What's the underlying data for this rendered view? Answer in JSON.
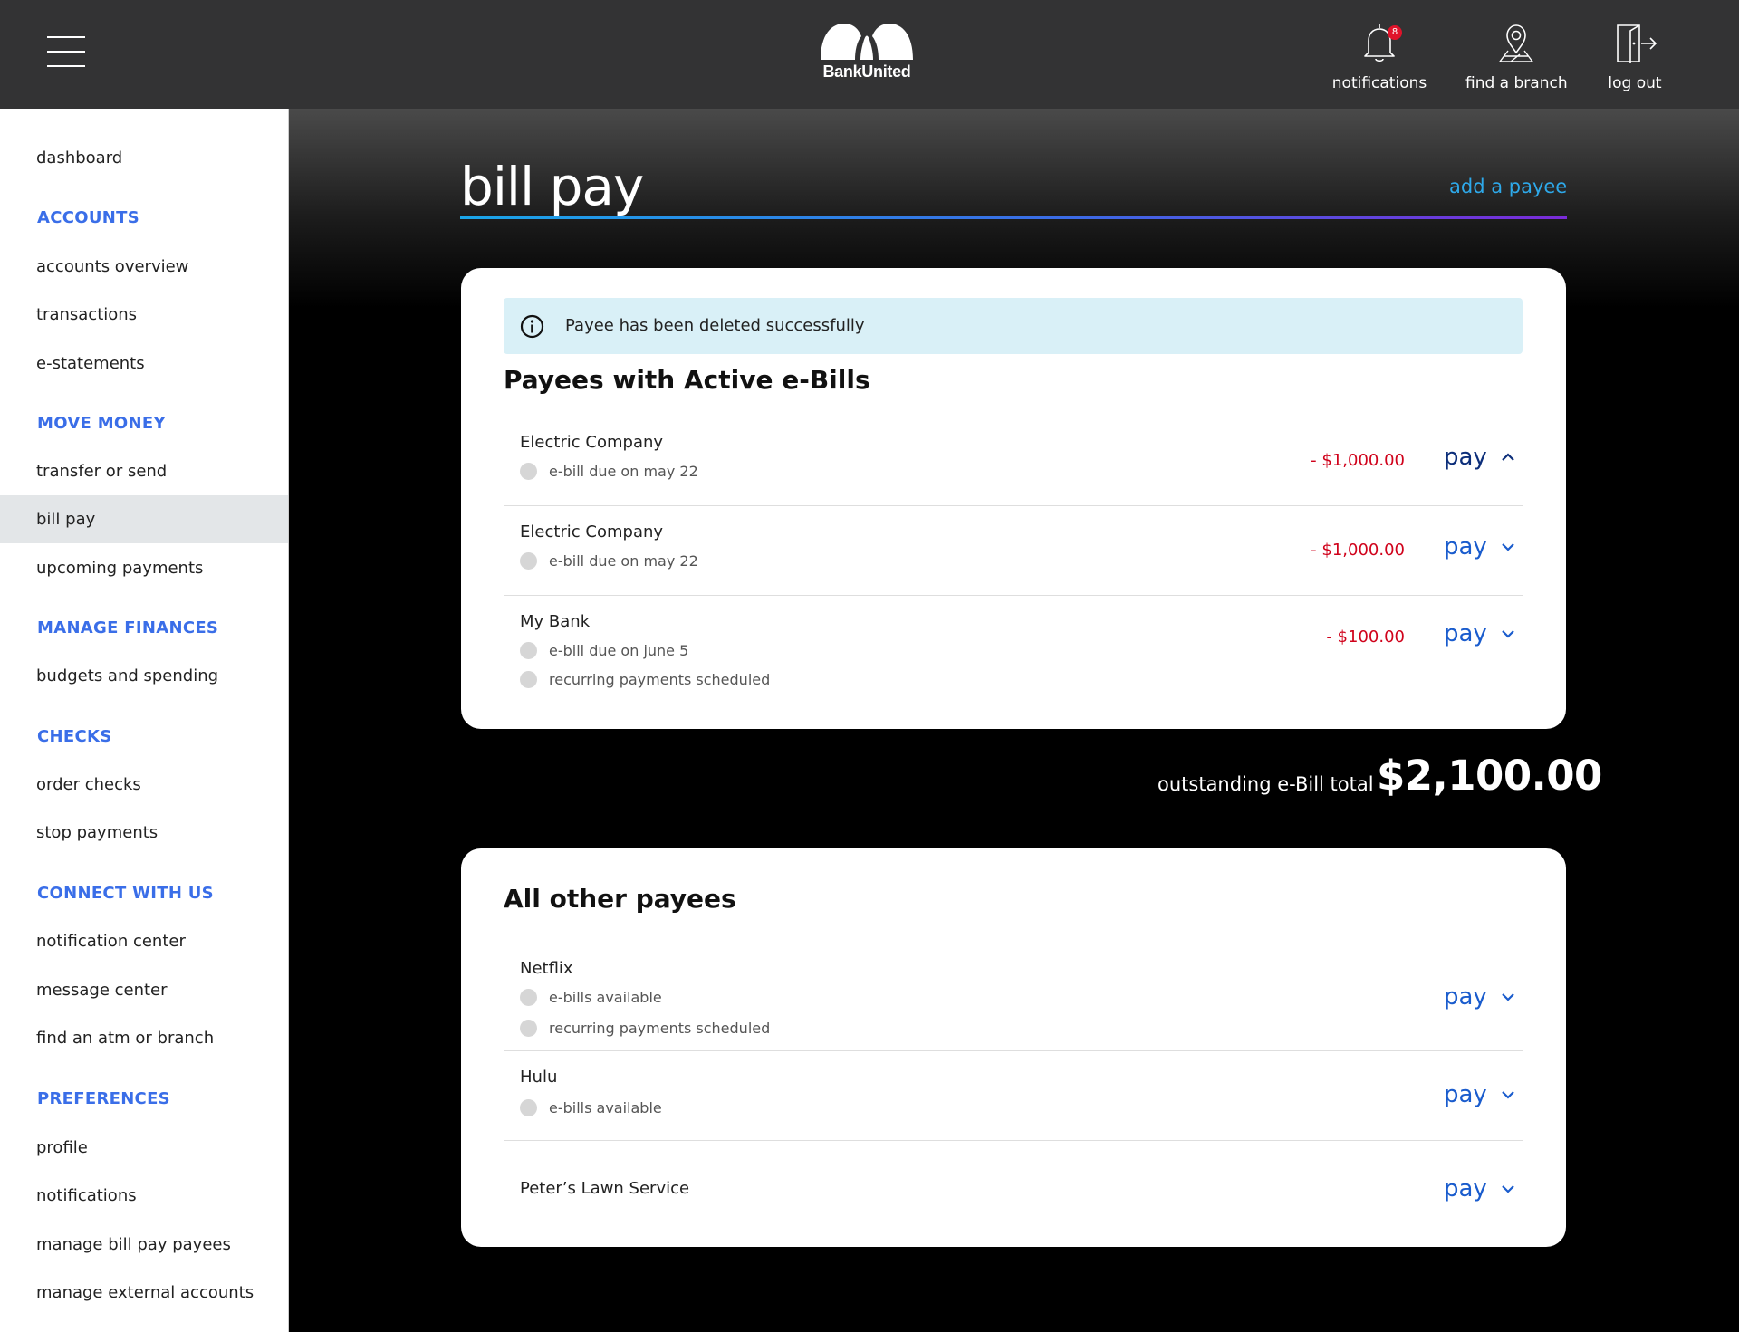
{
  "header": {
    "brand": "BankUnited",
    "notification_count": "8",
    "actions": [
      {
        "label": "notifications",
        "icon": "bell-icon"
      },
      {
        "label": "find a branch",
        "icon": "map-pin-icon"
      },
      {
        "label": "log out",
        "icon": "door-exit-icon"
      }
    ]
  },
  "sidebar": {
    "dashboard": "dashboard",
    "sections": [
      {
        "heading": "ACCOUNTS",
        "items": [
          "accounts overview",
          "transactions",
          "e-statements"
        ]
      },
      {
        "heading": "MOVE MONEY",
        "items": [
          "transfer or send",
          "bill pay",
          "upcoming payments"
        ]
      },
      {
        "heading": "MANAGE FINANCES",
        "items": [
          "budgets and spending"
        ]
      },
      {
        "heading": "CHECKS",
        "items": [
          "order checks",
          "stop payments"
        ]
      },
      {
        "heading": "CONNECT WITH US",
        "items": [
          "notification center",
          "message center",
          "find an atm or branch"
        ]
      },
      {
        "heading": "PREFERENCES",
        "items": [
          "profile",
          "notifications",
          "manage bill pay payees",
          "manage external accounts"
        ]
      }
    ],
    "active_item": "bill pay"
  },
  "page": {
    "title": "bill pay",
    "add_payee": "add a payee"
  },
  "alert": {
    "message": "Payee has been deleted successfully"
  },
  "ebills": {
    "title": "Payees with Active e-Bills",
    "payees": [
      {
        "name": "Electric Company",
        "details": [
          "e-bill due on may 22"
        ],
        "amount": "- $1,000.00",
        "pay": "pay",
        "expanded": true
      },
      {
        "name": "Electric Company",
        "details": [
          "e-bill due on may 22"
        ],
        "amount": "- $1,000.00",
        "pay": "pay",
        "expanded": false
      },
      {
        "name": "My Bank",
        "details": [
          "e-bill due on june 5",
          "recurring payments scheduled"
        ],
        "amount": "- $100.00",
        "pay": "pay",
        "expanded": false
      }
    ]
  },
  "total": {
    "label": "outstanding e-Bill total",
    "value": "$2,100.00"
  },
  "other": {
    "title": "All other payees",
    "payees": [
      {
        "name": "Netflix",
        "details": [
          "e-bills available",
          "recurring payments scheduled"
        ],
        "pay": "pay"
      },
      {
        "name": "Hulu",
        "details": [
          "e-bills available"
        ],
        "pay": "pay"
      },
      {
        "name": "Peter’s Lawn Service",
        "details": [],
        "pay": "pay"
      }
    ]
  },
  "colors": {
    "header_bg": "#333334",
    "accent_blue": "#3a6ee8",
    "link_blue": "#2ea9ea",
    "amount_red": "#d0021b",
    "alert_bg": "#d9f0f7"
  }
}
